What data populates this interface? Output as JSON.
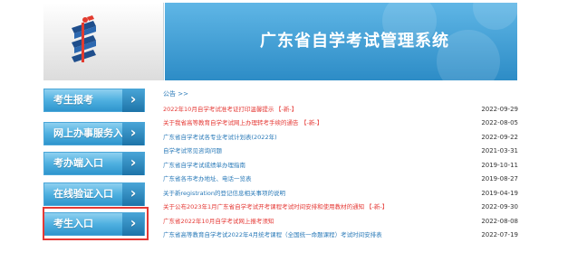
{
  "header": {
    "title": "广东省自学考试管理系统",
    "logo_icon": "exam-logo-icon",
    "banner_color": "#3a9ad4"
  },
  "sidebar": {
    "items": [
      {
        "label": "考生报考"
      },
      {
        "label": "网上办事服务入口"
      },
      {
        "label": "考办端入口"
      },
      {
        "label": "在线验证入口"
      },
      {
        "label": "考生入口"
      }
    ],
    "highlighted_item": "考生入口",
    "highlight_color": "#e53935"
  },
  "notices": {
    "heading": "公告 >>",
    "new_tag": "【-新-】",
    "items": [
      {
        "title": "2022年10月自学考试准考证打印温馨提示",
        "date": "2022-09-29",
        "color": "red",
        "new": true
      },
      {
        "title": "关于我省高等教育自学考试网上办理转考手续的通告",
        "date": "2022-08-05",
        "color": "red",
        "new": true
      },
      {
        "title": "广东省自学考试各专业考试计划表(2022年)",
        "date": "2022-09-22",
        "color": "blue",
        "new": false
      },
      {
        "title": "自学考试常见咨询问题",
        "date": "2021-03-31",
        "color": "blue",
        "new": false
      },
      {
        "title": "广东省自学考试成绩单办理指南",
        "date": "2019-10-11",
        "color": "blue",
        "new": false
      },
      {
        "title": "广东省各市考办地址、电话一览表",
        "date": "2019-08-27",
        "color": "blue",
        "new": false
      },
      {
        "title": "关于新registration的登记信息相关事项的说明",
        "date": "2019-04-19",
        "color": "blue",
        "new": false
      },
      {
        "title": "关于公布2023年1月广东省自学考试开考课程考试时间安排和使用教材的通知",
        "date": "2022-09-30",
        "color": "red",
        "new": true
      },
      {
        "title": "广东省2022年10月自学考试网上报考须知",
        "date": "2022-08-08",
        "color": "red",
        "new": false
      },
      {
        "title": "广东省高等教育自学考试2022年4月统考课程（全国统一命题课程）考试时间安排表",
        "date": "2022-07-19",
        "color": "blue",
        "new": false
      }
    ]
  }
}
